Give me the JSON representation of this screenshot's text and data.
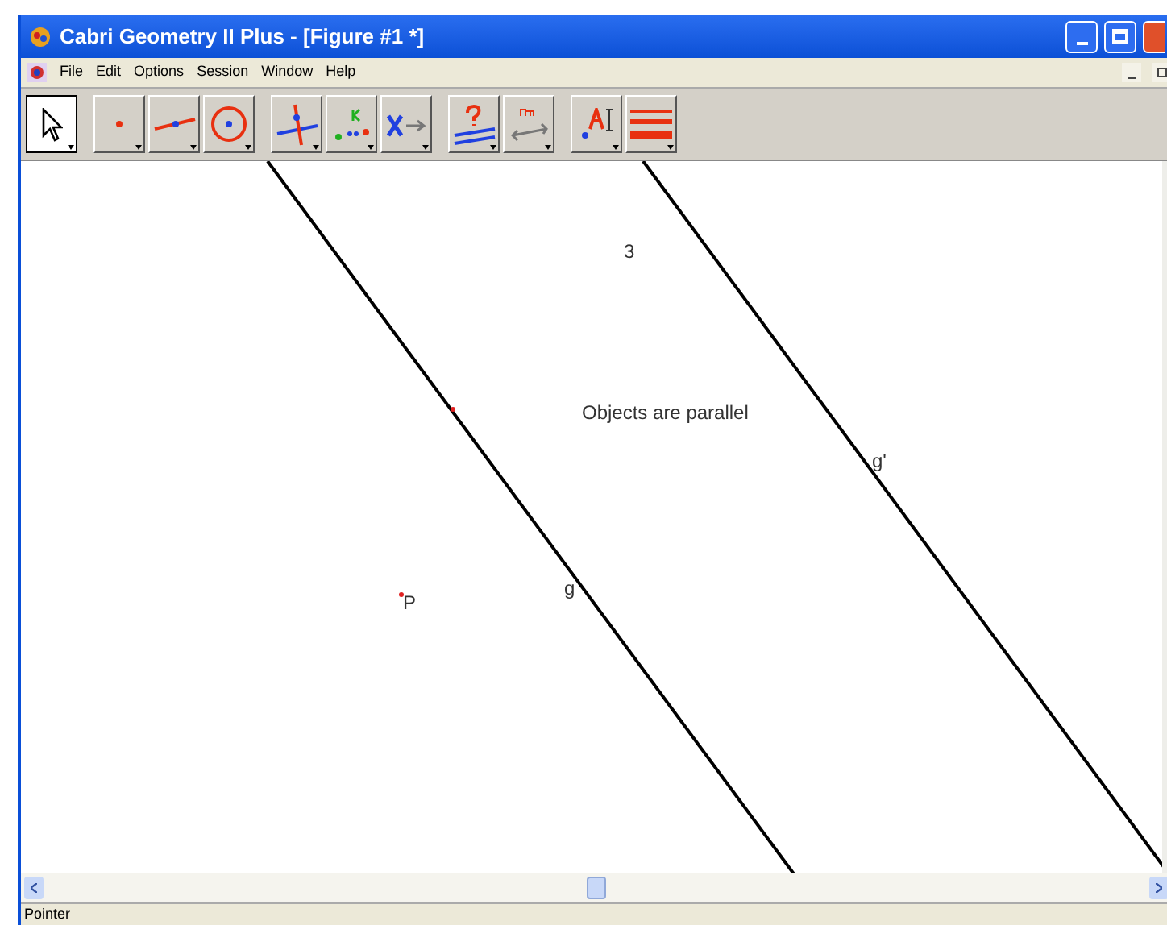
{
  "window": {
    "title": "Cabri Geometry II Plus - [Figure #1 *]"
  },
  "menu": [
    "File",
    "Edit",
    "Options",
    "Session",
    "Window",
    "Help"
  ],
  "toolbar": [
    {
      "kind": "pointer",
      "selected": true
    },
    {
      "kind": "point",
      "selected": false
    },
    {
      "kind": "line",
      "selected": false
    },
    {
      "kind": "circle",
      "selected": false
    },
    {
      "kind": "perpendicular",
      "selected": false
    },
    {
      "kind": "locus",
      "selected": false
    },
    {
      "kind": "transform",
      "selected": false
    },
    {
      "kind": "check",
      "selected": false
    },
    {
      "kind": "measure",
      "selected": false
    },
    {
      "kind": "text",
      "selected": false
    },
    {
      "kind": "display",
      "selected": false
    }
  ],
  "canvas": {
    "labels": [
      "3",
      "Objects are parallel",
      "g'",
      "g",
      "P"
    ]
  },
  "status_bar": "Pointer"
}
